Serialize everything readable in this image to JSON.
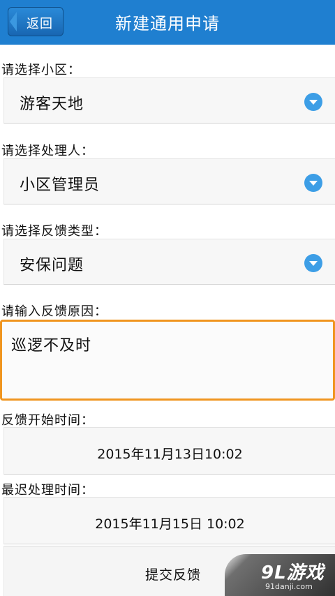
{
  "header": {
    "back_label": "返回",
    "title": "新建通用申请"
  },
  "form": {
    "community": {
      "label": "请选择小区：",
      "value": "游客天地"
    },
    "handler": {
      "label": "请选择处理人：",
      "value": "小区管理员"
    },
    "feedback_type": {
      "label": "请选择反馈类型：",
      "value": "安保问题"
    },
    "reason": {
      "label": "请输入反馈原因：",
      "value": "巡逻不及时"
    },
    "start_time": {
      "label": "反馈开始时间：",
      "value": "2015年11月13日10:02"
    },
    "deadline": {
      "label": "最迟处理时间：",
      "value": "2015年11月15日 10:02"
    },
    "submit_label": "提交反馈"
  },
  "watermark": {
    "logo_text": "9L游戏",
    "url": "91danji.com"
  },
  "colors": {
    "header_bg": "#1f7fd0",
    "dropdown_icon": "#3d9ee6",
    "focus_border": "#f0951f"
  },
  "icons": {
    "back": "arrow-left-icon",
    "dropdown": "chevron-down-icon"
  }
}
